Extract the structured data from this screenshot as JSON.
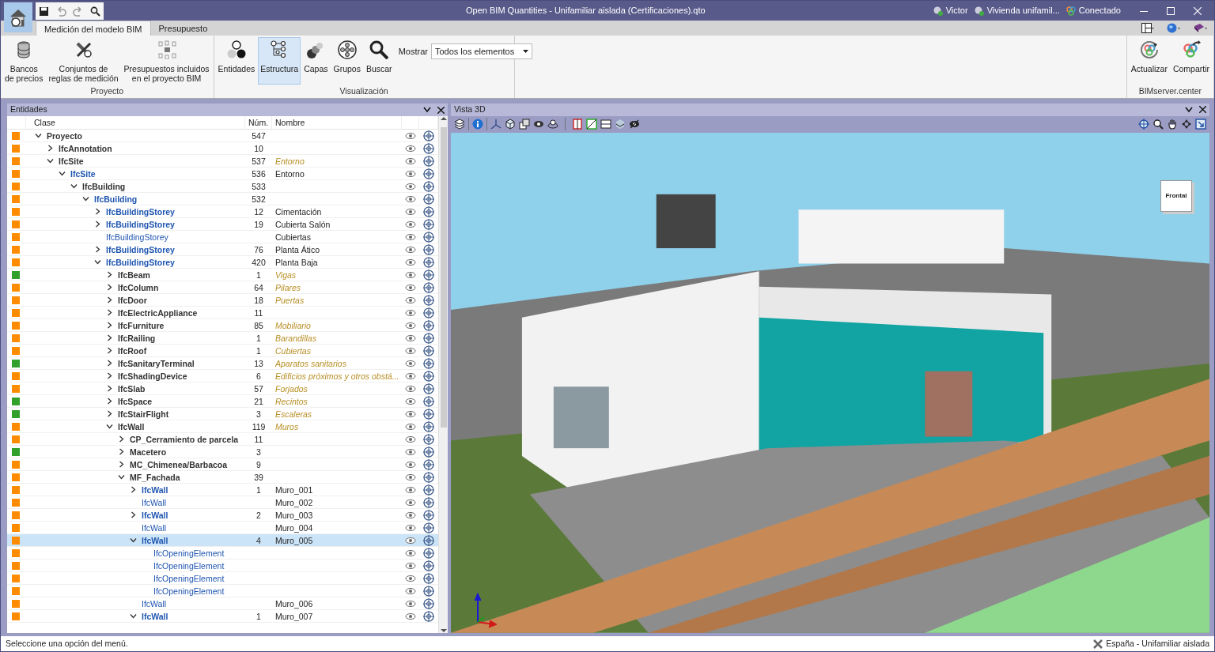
{
  "window": {
    "title": "Open BIM Quantities - Unifamiliar aislada (Certificaciones).qto",
    "status_items": [
      {
        "label": "Victor"
      },
      {
        "label": "Vivienda unifamil..."
      },
      {
        "label": "Conectado"
      }
    ]
  },
  "tabs": [
    {
      "label": "Medición del modelo BIM",
      "selected": true
    },
    {
      "label": "Presupuesto",
      "selected": false
    }
  ],
  "ribbon": {
    "groups": [
      {
        "title": "Proyecto",
        "buttons": [
          {
            "lines": [
              "Bancos",
              "de precios"
            ],
            "selected": false
          },
          {
            "lines": [
              "Conjuntos de",
              "reglas de medición"
            ],
            "selected": false
          },
          {
            "lines": [
              "Presupuestos incluidos",
              "en el proyecto BIM"
            ],
            "selected": false
          }
        ]
      },
      {
        "title": "Visualización",
        "buttons": [
          {
            "lines": [
              "Entidades"
            ],
            "selected": false
          },
          {
            "lines": [
              "Estructura"
            ],
            "selected": true
          },
          {
            "lines": [
              "Capas"
            ],
            "selected": false
          },
          {
            "lines": [
              "Grupos"
            ],
            "selected": false
          },
          {
            "lines": [
              "Buscar"
            ],
            "selected": false
          }
        ],
        "filter": {
          "label": "Mostrar",
          "value": "Todos los elementos"
        }
      },
      {
        "title": "BIMserver.center",
        "buttons": [
          {
            "lines": [
              "Actualizar"
            ],
            "selected": false
          },
          {
            "lines": [
              "Compartir"
            ],
            "selected": false
          }
        ]
      }
    ]
  },
  "entities": {
    "title": "Entidades",
    "columns": [
      "Clase",
      "Núm.",
      "Nombre"
    ],
    "rows": [
      {
        "kind": "class",
        "label": "Proyecto",
        "count": "547",
        "color": "#ff8c00",
        "selected": false,
        "expanded": true,
        "children": [
          {
            "kind": "class",
            "label": "IfcAnnotation",
            "count": "10",
            "color": "#ff8c00",
            "selected": false,
            "expanded": false
          },
          {
            "kind": "class",
            "label": "IfcSite",
            "count": "537",
            "name": "Entorno",
            "color": "#ff8c00",
            "selected": false,
            "expanded": true,
            "children": [
              {
                "kind": "instance",
                "label": "IfcSite",
                "count": "536",
                "name": "Entorno",
                "color": "#ff8c00",
                "selected": false,
                "expanded": true,
                "children": [
                  {
                    "kind": "class",
                    "label": "IfcBuilding",
                    "count": "533",
                    "color": "#ff8c00",
                    "selected": false,
                    "expanded": true,
                    "children": [
                      {
                        "kind": "instance",
                        "label": "IfcBuilding",
                        "count": "532",
                        "color": "#ff8c00",
                        "selected": false,
                        "expanded": true,
                        "children": [
                          {
                            "kind": "instance",
                            "label": "IfcBuildingStorey",
                            "count": "12",
                            "name": "Cimentación",
                            "color": "#ff8c00",
                            "selected": false,
                            "expanded": false
                          },
                          {
                            "kind": "instance",
                            "label": "IfcBuildingStorey",
                            "count": "19",
                            "name": "Cubierta Salón",
                            "color": "#ff8c00",
                            "selected": false,
                            "expanded": false
                          },
                          {
                            "kind": "instance",
                            "label": "IfcBuildingStorey",
                            "name": "Cubiertas",
                            "color": "#ff8c00",
                            "selected": false
                          },
                          {
                            "kind": "instance",
                            "label": "IfcBuildingStorey",
                            "count": "76",
                            "name": "Planta Ático",
                            "color": "#ff8c00",
                            "selected": false,
                            "expanded": false
                          },
                          {
                            "kind": "instance",
                            "label": "IfcBuildingStorey",
                            "count": "420",
                            "name": "Planta Baja",
                            "color": "#ff8c00",
                            "selected": false,
                            "expanded": true,
                            "children": [
                              {
                                "kind": "class",
                                "label": "IfcBeam",
                                "count": "1",
                                "name": "Vigas",
                                "color": "#33a02c",
                                "selected": false,
                                "expanded": false
                              },
                              {
                                "kind": "class",
                                "label": "IfcColumn",
                                "count": "64",
                                "name": "Pilares",
                                "color": "#ff8c00",
                                "selected": false,
                                "expanded": false
                              },
                              {
                                "kind": "class",
                                "label": "IfcDoor",
                                "count": "18",
                                "name": "Puertas",
                                "color": "#ff8c00",
                                "selected": false,
                                "expanded": false
                              },
                              {
                                "kind": "class",
                                "label": "IfcElectricAppliance",
                                "count": "11",
                                "color": "#ff8c00",
                                "selected": false,
                                "expanded": false
                              },
                              {
                                "kind": "class",
                                "label": "IfcFurniture",
                                "count": "85",
                                "name": "Mobiliario",
                                "color": "#ff8c00",
                                "selected": false,
                                "expanded": false
                              },
                              {
                                "kind": "class",
                                "label": "IfcRailing",
                                "count": "1",
                                "name": "Barandillas",
                                "color": "#ff8c00",
                                "selected": false,
                                "expanded": false
                              },
                              {
                                "kind": "class",
                                "label": "IfcRoof",
                                "count": "1",
                                "name": "Cubiertas",
                                "color": "#ff8c00",
                                "selected": false,
                                "expanded": false
                              },
                              {
                                "kind": "class",
                                "label": "IfcSanitaryTerminal",
                                "count": "13",
                                "name": "Aparatos sanitarios",
                                "color": "#33a02c",
                                "selected": false,
                                "expanded": false
                              },
                              {
                                "kind": "class",
                                "label": "IfcShadingDevice",
                                "count": "6",
                                "name": "Edificios próximos y otros obstá...",
                                "color": "#ff8c00",
                                "selected": false,
                                "expanded": false
                              },
                              {
                                "kind": "class",
                                "label": "IfcSlab",
                                "count": "57",
                                "name": "Forjados",
                                "color": "#ff8c00",
                                "selected": false,
                                "expanded": false
                              },
                              {
                                "kind": "class",
                                "label": "IfcSpace",
                                "count": "21",
                                "name": "Recintos",
                                "color": "#33a02c",
                                "selected": false,
                                "expanded": false
                              },
                              {
                                "kind": "class",
                                "label": "IfcStairFlight",
                                "count": "3",
                                "name": "Escaleras",
                                "color": "#33a02c",
                                "selected": false,
                                "expanded": false
                              },
                              {
                                "kind": "class",
                                "label": "IfcWall",
                                "count": "119",
                                "name": "Muros",
                                "color": "#ff8c00",
                                "selected": false,
                                "expanded": true,
                                "children": [
                                  {
                                    "kind": "class",
                                    "label": "CP_Cerramiento de parcela",
                                    "count": "11",
                                    "color": "#ff8c00",
                                    "selected": false,
                                    "expanded": false
                                  },
                                  {
                                    "kind": "class",
                                    "label": "Macetero",
                                    "count": "3",
                                    "color": "#33a02c",
                                    "selected": false,
                                    "expanded": false
                                  },
                                  {
                                    "kind": "class",
                                    "label": "MC_Chimenea/Barbacoa",
                                    "count": "9",
                                    "color": "#ff8c00",
                                    "selected": false,
                                    "expanded": false
                                  },
                                  {
                                    "kind": "class",
                                    "label": "MF_Fachada",
                                    "count": "39",
                                    "color": "#ff8c00",
                                    "selected": false,
                                    "expanded": true,
                                    "children": [
                                      {
                                        "kind": "instance",
                                        "label": "IfcWall",
                                        "count": "1",
                                        "name": "Muro_001",
                                        "color": "#ff8c00",
                                        "selected": false,
                                        "expanded": false
                                      },
                                      {
                                        "kind": "instance",
                                        "label": "IfcWall",
                                        "name": "Muro_002",
                                        "color": "#ff8c00",
                                        "selected": false
                                      },
                                      {
                                        "kind": "instance",
                                        "label": "IfcWall",
                                        "count": "2",
                                        "name": "Muro_003",
                                        "color": "#ff8c00",
                                        "selected": false,
                                        "expanded": false
                                      },
                                      {
                                        "kind": "instance",
                                        "label": "IfcWall",
                                        "name": "Muro_004",
                                        "color": "#ff8c00",
                                        "selected": false
                                      },
                                      {
                                        "kind": "instance",
                                        "label": "IfcWall",
                                        "count": "4",
                                        "name": "Muro_005",
                                        "color": "#ff8c00",
                                        "selected": true,
                                        "expanded": true,
                                        "children": [
                                          {
                                            "kind": "instance",
                                            "label": "IfcOpeningElement",
                                            "color": "#ff8c00",
                                            "selected": false
                                          },
                                          {
                                            "kind": "instance",
                                            "label": "IfcOpeningElement",
                                            "color": "#ff8c00",
                                            "selected": false
                                          },
                                          {
                                            "kind": "instance",
                                            "label": "IfcOpeningElement",
                                            "color": "#ff8c00",
                                            "selected": false
                                          },
                                          {
                                            "kind": "instance",
                                            "label": "IfcOpeningElement",
                                            "color": "#ff8c00",
                                            "selected": false
                                          }
                                        ]
                                      },
                                      {
                                        "kind": "instance",
                                        "label": "IfcWall",
                                        "name": "Muro_006",
                                        "color": "#ff8c00",
                                        "selected": false
                                      },
                                      {
                                        "kind": "instance",
                                        "label": "IfcWall",
                                        "count": "1",
                                        "name": "Muro_007",
                                        "color": "#ff8c00",
                                        "selected": false,
                                        "expanded": true
                                      }
                                    ]
                                  }
                                ]
                              }
                            ]
                          }
                        ]
                      }
                    ]
                  }
                ]
              }
            ]
          }
        ]
      }
    ]
  },
  "view": {
    "title": "Vista 3D",
    "cube_label": "Frontal"
  },
  "status_bar": {
    "message": "Seleccione una opción del menú.",
    "location": "España - Unifamiliar aislada"
  }
}
